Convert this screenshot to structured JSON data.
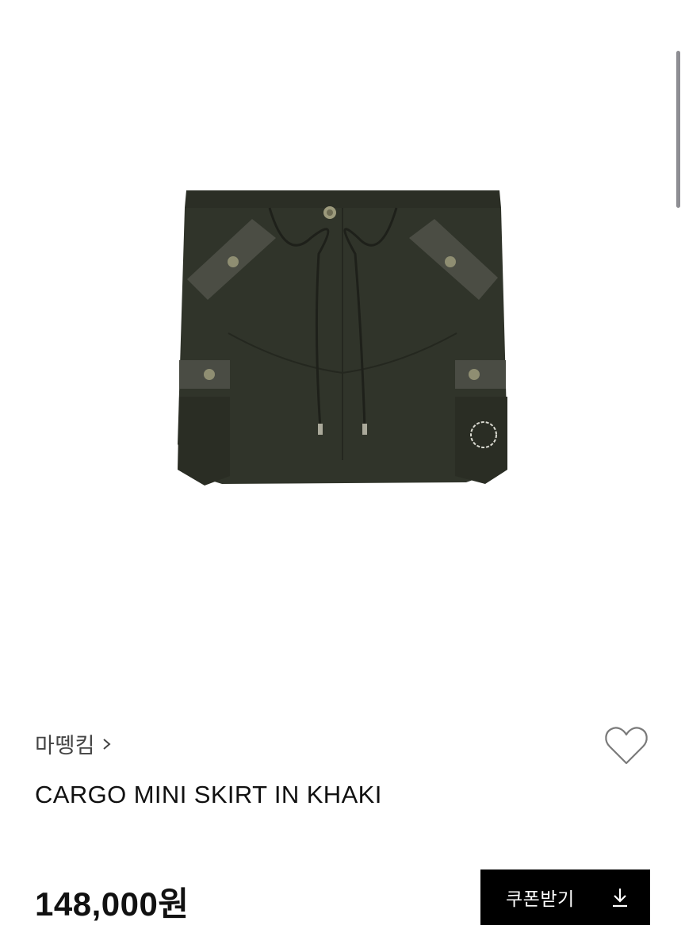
{
  "product": {
    "brand": "마뗑킴",
    "title": "CARGO MINI SKIRT IN KHAKI",
    "price": "148,000원",
    "image_subject": "khaki cargo mini skirt with drawstring waist and leather-trim cargo pockets"
  },
  "actions": {
    "coupon_label": "쿠폰받기"
  },
  "icons": {
    "brand_chevron": "chevron-right-icon",
    "wishlist": "heart-outline-icon",
    "coupon": "download-icon"
  },
  "colors": {
    "skirt": "#2f3328",
    "trim": "#4d4f47",
    "button_bg": "#000000",
    "button_text": "#ffffff"
  }
}
